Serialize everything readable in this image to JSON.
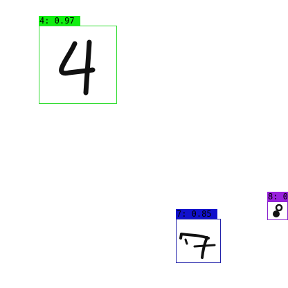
{
  "detections": [
    {
      "digit": "4",
      "label": "4: 0.97",
      "box_color": "#33dd33",
      "label_bg": "#11ee11"
    },
    {
      "digit": "7",
      "label": "7: 0.85",
      "box_color": "#2222aa",
      "label_bg": "#1111cc"
    },
    {
      "digit": "8",
      "label": "8: 0",
      "box_color": "#8822cc",
      "label_bg": "#9922dd"
    }
  ]
}
